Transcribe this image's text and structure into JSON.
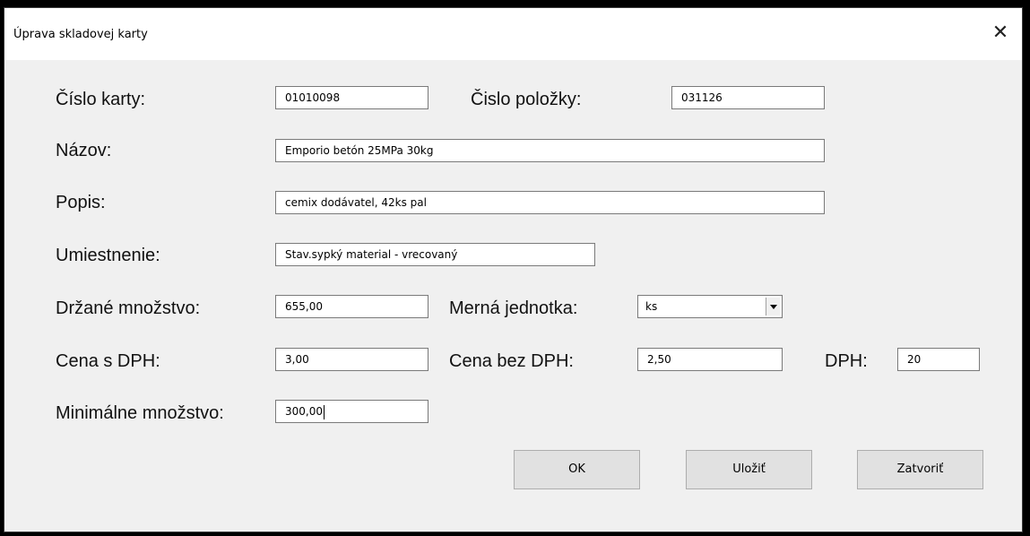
{
  "window": {
    "title": "Úprava skladovej karty",
    "close_glyph": "✕"
  },
  "form": {
    "cislo_karty": {
      "label": "Číslo karty:",
      "value": "01010098"
    },
    "cislo_polozky": {
      "label": "Čislo položky:",
      "value": "031126"
    },
    "nazov": {
      "label": "Názov:",
      "value": "Emporio betón 25MPa 30kg"
    },
    "popis": {
      "label": "Popis:",
      "value": "cemix dodávatel, 42ks pal"
    },
    "umiestnenie": {
      "label": "Umiestnenie:",
      "value": "Stav.sypký material - vrecovaný"
    },
    "drzane_mnozstvo": {
      "label": "Držané množstvo:",
      "value": "655,00"
    },
    "merna_jednotka": {
      "label": "Merná jednotka:",
      "value": "ks"
    },
    "cena_s_dph": {
      "label": "Cena s DPH:",
      "value": "3,00"
    },
    "cena_bez_dph": {
      "label": "Cena bez DPH:",
      "value": "2,50"
    },
    "dph": {
      "label": "DPH:",
      "value": "20"
    },
    "minimalne_mnozstvo": {
      "label": "Minimálne množstvo:",
      "value": "300,00"
    }
  },
  "buttons": {
    "ok": "OK",
    "ulozit": "Uložiť",
    "zatvorit": "Zatvoriť"
  }
}
